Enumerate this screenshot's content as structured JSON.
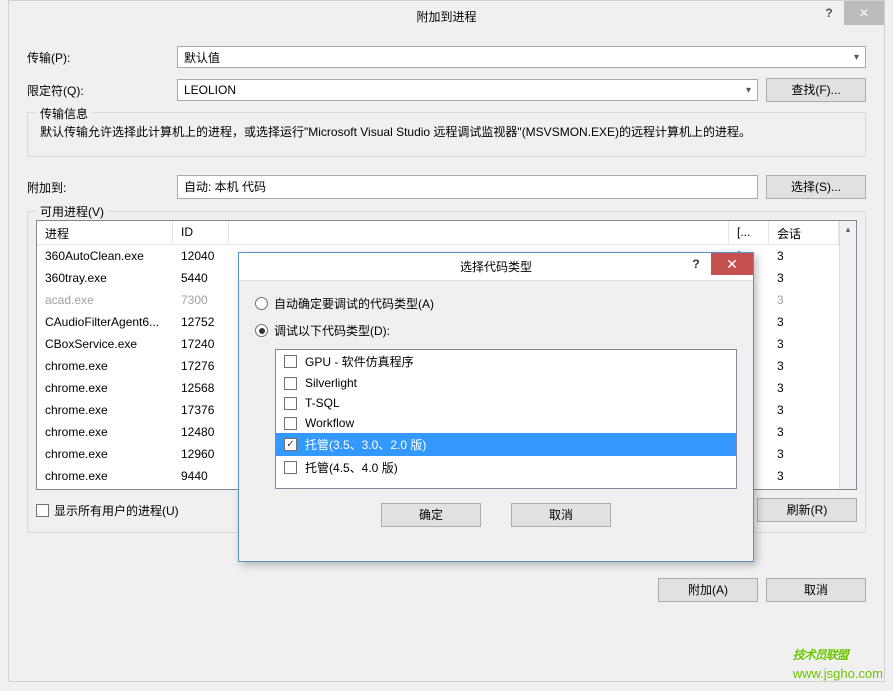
{
  "main": {
    "title": "附加到进程",
    "transport_label": "传输(P):",
    "transport_value": "默认值",
    "qualifier_label": "限定符(Q):",
    "qualifier_value": "LEOLION",
    "find_btn": "查找(F)...",
    "transport_info_legend": "传输信息",
    "transport_info_text": "默认传输允许选择此计算机上的进程，或选择运行\"Microsoft Visual Studio 远程调试监视器\"(MSVSMON.EXE)的远程计算机上的进程。",
    "attach_label": "附加到:",
    "attach_value": "自动: 本机 代码",
    "select_btn": "选择(S)...",
    "proc_legend": "可用进程(V)",
    "columns": {
      "proc": "进程",
      "id": "ID",
      "title_col": "[...",
      "session": "会话"
    },
    "processes": [
      {
        "name": "360AutoClean.exe",
        "id": "12040",
        "title": "[...",
        "session": "3",
        "disabled": false
      },
      {
        "name": "360tray.exe",
        "id": "5440",
        "title": "[...",
        "session": "3",
        "disabled": false
      },
      {
        "name": "acad.exe",
        "id": "7300",
        "title": "",
        "session": "3",
        "disabled": true
      },
      {
        "name": "CAudioFilterAgent6...",
        "id": "12752",
        "title": "[...",
        "session": "3",
        "disabled": false
      },
      {
        "name": "CBoxService.exe",
        "id": "17240",
        "title": "[...",
        "session": "3",
        "disabled": false
      },
      {
        "name": "chrome.exe",
        "id": "17276",
        "title": "[...",
        "session": "3",
        "disabled": false
      },
      {
        "name": "chrome.exe",
        "id": "12568",
        "title": "[...",
        "session": "3",
        "disabled": false
      },
      {
        "name": "chrome.exe",
        "id": "17376",
        "title": "[...",
        "session": "3",
        "disabled": false
      },
      {
        "name": "chrome.exe",
        "id": "12480",
        "title": "[...",
        "session": "3",
        "disabled": false
      },
      {
        "name": "chrome.exe",
        "id": "12960",
        "title": "[...",
        "session": "3",
        "disabled": false
      },
      {
        "name": "chrome.exe",
        "id": "9440",
        "title": "[...",
        "session": "3",
        "disabled": false
      }
    ],
    "show_all_label": "显示所有用户的进程(U)",
    "refresh_btn": "刷新(R)",
    "attach_btn": "附加(A)",
    "cancel_btn": "取消"
  },
  "inner": {
    "title": "选择代码类型",
    "auto_label": "自动确定要调试的代码类型(A)",
    "debug_label": "调试以下代码类型(D):",
    "items": [
      {
        "label": "GPU - 软件仿真程序",
        "checked": false,
        "selected": false
      },
      {
        "label": "Silverlight",
        "checked": false,
        "selected": false
      },
      {
        "label": "T-SQL",
        "checked": false,
        "selected": false
      },
      {
        "label": "Workflow",
        "checked": false,
        "selected": false
      },
      {
        "label": "托管(3.5、3.0、2.0 版)",
        "checked": true,
        "selected": true
      },
      {
        "label": "托管(4.5、4.0 版)",
        "checked": false,
        "selected": false
      }
    ],
    "ok_btn": "确定",
    "cancel_btn": "取消"
  },
  "watermark": {
    "cn": "技术员联盟",
    "url": "www.jsgho.com"
  }
}
